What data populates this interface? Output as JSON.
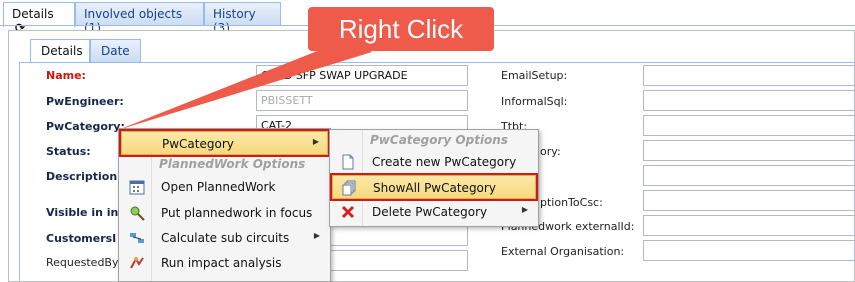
{
  "top_tabs": {
    "details": "Details",
    "involved": "Involved objects (1)",
    "history": "History (3)"
  },
  "sub_tabs": {
    "details": "Details",
    "date": "Date"
  },
  "annotation": {
    "text": "Right Click"
  },
  "left_labels": {
    "name": "Name:",
    "pw_engineer": "PwEngineer:",
    "pw_category": "PwCategory:",
    "status": "Status:",
    "description": "Description",
    "visible_in": "Visible in in",
    "customers": "CustomersI",
    "requested_by": "RequestedBy"
  },
  "left_values": {
    "name": "CARD SFP SWAP UPGRADE",
    "pw_engineer": "PBISSETT",
    "pw_category": "CAT-2"
  },
  "right_labels": {
    "email_setup": "EmailSetup:",
    "informal_sql": "InformalSql:",
    "ttbt": "Ttbt:",
    "category_part": "ory:",
    "option_to_csc": "ptionToCsc:",
    "planned_external": "Plannedwork externalId:",
    "external_org": "External Organisation:"
  },
  "menu1": {
    "pwcategory_item": "PwCategory",
    "planned_header": "PlannedWork Options",
    "items": [
      "Open PlannedWork",
      "Put plannedwork in focus",
      "Calculate sub circuits",
      "Run impact analysis"
    ]
  },
  "menu2": {
    "header": "PwCategory Options",
    "items": [
      "Create new PwCategory",
      "ShowAll PwCategory",
      "Delete PwCategory"
    ]
  },
  "colors": {
    "callout": "#ef5b4b",
    "highlight_box": "#d01a1a",
    "required_label": "#d0140c"
  }
}
